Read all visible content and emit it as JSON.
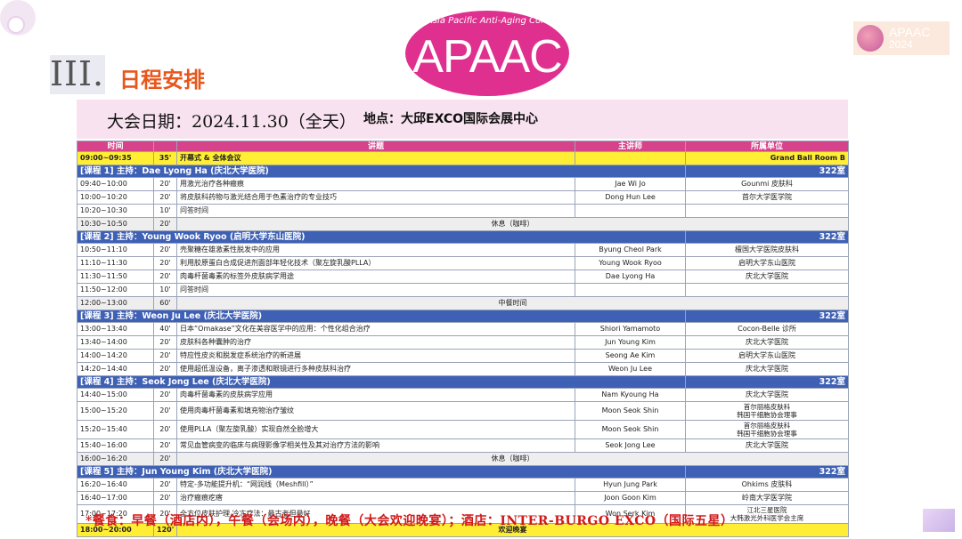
{
  "header": {
    "roman_numeral": "III.",
    "section_title": "日程安排",
    "logo_subtitle": "Asia Pacific Anti-Aging Confer",
    "logo_text": "APAAC",
    "corner_logo_text": "APAAC",
    "corner_logo_year": "2024"
  },
  "event": {
    "date_label": "大会日期：2024.11.30（全天）",
    "venue_label": "地点：大邱EXCO国际会展中心"
  },
  "table_headers": [
    "时间",
    "",
    "讲题",
    "主讲师",
    "所属单位"
  ],
  "rows": [
    {
      "kind": "yellow",
      "time": "09:00~09:35",
      "dur": "35'",
      "topic": "开幕式 & 全体会议",
      "speaker": "",
      "aff": "Grand Ball Room B"
    },
    {
      "kind": "session",
      "text": "[课程 1] 主持：Dae Lyong Ha (庆北大学医院)",
      "room": "322室"
    },
    {
      "kind": "normal",
      "time": "09:40~10:00",
      "dur": "20'",
      "topic": "用激光治疗各种瘢痕",
      "speaker": "Jae Wi Jo",
      "aff": "Gounmi 皮肤科"
    },
    {
      "kind": "normal",
      "time": "10:00~10:20",
      "dur": "20'",
      "topic": "将皮肤科药物与激光结合用于色素治疗的专业技巧",
      "speaker": "Dong Hun Lee",
      "aff": "首尔大学医学院"
    },
    {
      "kind": "normal",
      "time": "10:20~10:30",
      "dur": "10'",
      "topic": "问答时间",
      "speaker": "",
      "aff": ""
    },
    {
      "kind": "break",
      "time": "10:30~10:50",
      "dur": "20'",
      "text": "休息（咖啡）"
    },
    {
      "kind": "session",
      "text": "[课程 2] 主持：Young Wook Ryoo (启明大学东山医院)",
      "room": "322室"
    },
    {
      "kind": "normal",
      "time": "10:50~11:10",
      "dur": "20'",
      "topic": "壳聚糖在雄激素性脱发中的应用",
      "speaker": "Byung Cheol Park",
      "aff": "檀国大学医院皮肤科"
    },
    {
      "kind": "normal",
      "time": "11:10~11:30",
      "dur": "20'",
      "topic": "利用胶原蛋白合成促进剂面部年轻化技术（聚左旋乳酸PLLA）",
      "speaker": "Young Wook Ryoo",
      "aff": "启明大学东山医院"
    },
    {
      "kind": "normal",
      "time": "11:30~11:50",
      "dur": "20'",
      "topic": "肉毒杆菌毒素的标签外皮肤病学用途",
      "speaker": "Dae Lyong Ha",
      "aff": "庆北大学医院"
    },
    {
      "kind": "normal",
      "time": "11:50~12:00",
      "dur": "10'",
      "topic": "问答时间",
      "speaker": "",
      "aff": ""
    },
    {
      "kind": "break",
      "time": "12:00~13:00",
      "dur": "60'",
      "text": "中餐时间"
    },
    {
      "kind": "session",
      "text": "[课程 3] 主持：Weon Ju Lee (庆北大学医院)",
      "room": "322室"
    },
    {
      "kind": "normal",
      "time": "13:00~13:40",
      "dur": "40'",
      "topic": "日本“Omakase”文化在美容医学中的应用：个性化组合治疗",
      "speaker": "Shiori Yamamoto",
      "aff": "Cocon-Belle 诊所"
    },
    {
      "kind": "normal",
      "time": "13:40~14:00",
      "dur": "20'",
      "topic": "皮肤科各种囊肿的治疗",
      "speaker": "Jun Young Kim",
      "aff": "庆北大学医院"
    },
    {
      "kind": "normal",
      "time": "14:00~14:20",
      "dur": "20'",
      "topic": "特应性皮炎和脱发症系统治疗的新进展",
      "speaker": "Seong Ae Kim",
      "aff": "启明大学东山医院"
    },
    {
      "kind": "normal",
      "time": "14:20~14:40",
      "dur": "20'",
      "topic": "使用超低温设备，离子渗透和眼镜进行多种皮肤科治疗",
      "speaker": "Weon Ju Lee",
      "aff": "庆北大学医院"
    },
    {
      "kind": "session",
      "text": "[课程 4] 主持：Seok Jong Lee (庆北大学医院)",
      "room": "322室"
    },
    {
      "kind": "normal",
      "time": "14:40~15:00",
      "dur": "20'",
      "topic": "肉毒杆菌毒素的皮肤病学应用",
      "speaker": "Nam Kyoung Ha",
      "aff": "庆北大学医院"
    },
    {
      "kind": "tall",
      "time": "15:00~15:20",
      "dur": "20'",
      "topic": "使用肉毒杆菌毒素和填充物治疗皱纹",
      "speaker": "Moon Seok Shin",
      "aff": "首尔丽格皮肤科",
      "aff2": "韩国干细胞协会理事"
    },
    {
      "kind": "tall",
      "time": "15:20~15:40",
      "dur": "20'",
      "topic": "使用PLLA（聚左旋乳酸）实现自然全脸增大",
      "speaker": "Moon Seok Shin",
      "aff": "首尔丽格皮肤科",
      "aff2": "韩国干细胞协会理事"
    },
    {
      "kind": "normal",
      "time": "15:40~16:00",
      "dur": "20'",
      "topic": "常见血管病变的临床与病理影像学相关性及其对治疗方法的影响",
      "speaker": "Seok Jong Lee",
      "aff": "庆北大学医院"
    },
    {
      "kind": "break",
      "time": "16:00~16:20",
      "dur": "20'",
      "text": "休息（咖啡）"
    },
    {
      "kind": "session",
      "text": "[课程 5] 主持：Jun Young Kim (庆北大学医院)",
      "room": "322室"
    },
    {
      "kind": "normal",
      "time": "16:20~16:40",
      "dur": "20'",
      "topic": "特定-多功能提升机：“网润线（Meshfill）”",
      "speaker": "Hyun Jung Park",
      "aff": "Ohkims 皮肤科"
    },
    {
      "kind": "normal",
      "time": "16:40~17:00",
      "dur": "20'",
      "topic": "治疗瘢痕疙瘩",
      "speaker": "Joon Goon Kim",
      "aff": "岭南大学医学院"
    },
    {
      "kind": "tall",
      "time": "17:00~17:20",
      "dur": "20'",
      "topic": "全方位皮肤护理,冷冻疗法：最古老但最好",
      "speaker": "Won Serk Kim",
      "aff": "江北三星医院",
      "aff2": "大韩激光外科医学会主席"
    },
    {
      "kind": "yellow",
      "time": "18:00~20:00",
      "dur": "120'",
      "topic": "",
      "speaker": "",
      "aff": "",
      "center": "欢迎晚宴"
    }
  ],
  "footnote": "*餐食：早餐（酒店内），午餐（会场内），晚餐（大会欢迎晚宴）；酒店：INTER-BURGO EXCO（国际五星）",
  "colors": {
    "header_pink": "#d7438a",
    "session_blue": "#3e60b5",
    "highlight_yellow": "#ffee33",
    "title_orange": "#e8561c",
    "logo_magenta": "#e0308f",
    "footnote_red": "#d01818"
  }
}
